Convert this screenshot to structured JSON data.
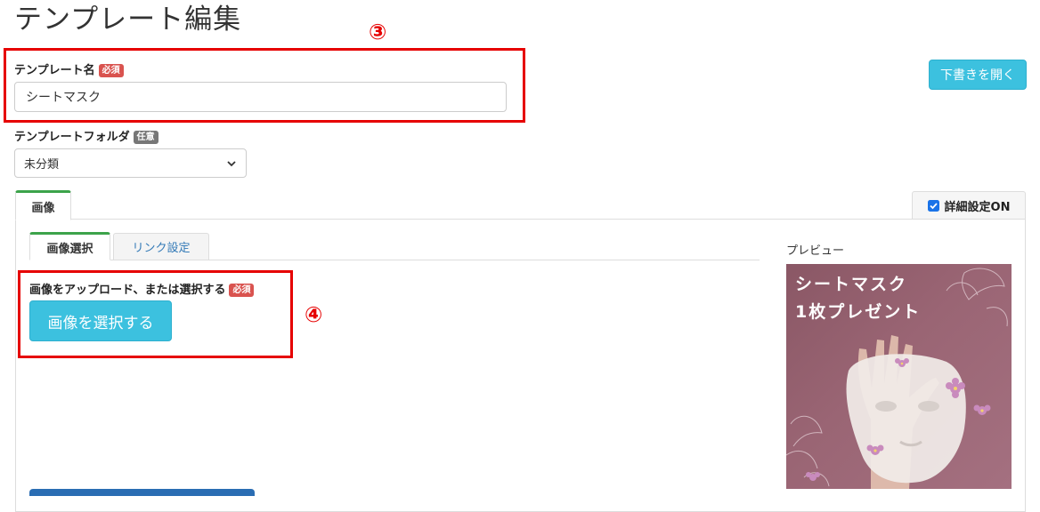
{
  "page": {
    "title": "テンプレート編集"
  },
  "annotations": {
    "step3": "③",
    "step4": "④"
  },
  "template_name": {
    "label": "テンプレート名",
    "badge": "必須",
    "value": "シートマスク"
  },
  "template_folder": {
    "label": "テンプレートフォルダ",
    "badge": "任意",
    "selected": "未分類"
  },
  "draft_button": {
    "label": "下書きを開く"
  },
  "outer_tab": {
    "label": "画像"
  },
  "advanced": {
    "label": "詳細設定ON",
    "checked": true
  },
  "inner_tabs": [
    {
      "label": "画像選択"
    },
    {
      "label": "リンク設定"
    }
  ],
  "upload": {
    "label": "画像をアップロード、または選択する",
    "badge": "必須",
    "button_label": "画像を選択する"
  },
  "preview": {
    "heading": "プレビュー",
    "line1": "シートマスク",
    "line2": "1枚プレゼント"
  },
  "colors": {
    "accent": "#3cc1df",
    "required": "#d9534f",
    "annotation": "#e60000",
    "active_tab": "#3ca34a",
    "dark_button": "#2a6db3"
  },
  "icons": {
    "select": "chevron-down-icon",
    "checkbox": "checkbox-checked-icon"
  }
}
